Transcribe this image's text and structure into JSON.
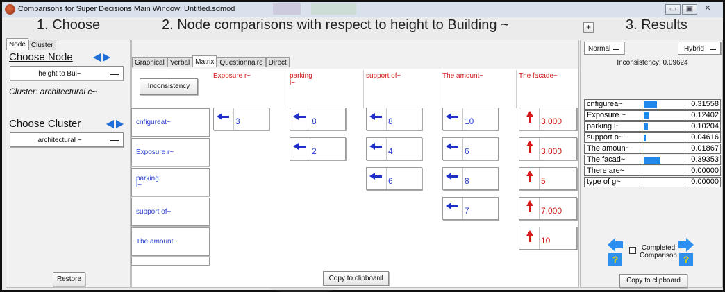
{
  "window": {
    "title": "Comparisons for Super Decisions Main Window: Untitled.sdmod"
  },
  "panels": {
    "choose": "1. Choose",
    "comparisons": "2. Node comparisons with respect to height  to Building ~",
    "results": "3. Results"
  },
  "left": {
    "tabs": [
      "Node",
      "Cluster"
    ],
    "choose_node_label": "Choose Node",
    "node_value": "height to Bui~",
    "cluster_text": "Cluster: architectural c~",
    "choose_cluster_label": "Choose Cluster",
    "cluster_value": "architectural ~",
    "restore": "Restore"
  },
  "middle": {
    "tabs": [
      "Graphical",
      "Verbal",
      "Matrix",
      "Questionnaire",
      "Direct"
    ],
    "inconsistency_button": "Inconsistency",
    "columns": [
      "Exposure r~",
      "parking\nl~",
      "support of~",
      "The amount~",
      "The facade~"
    ],
    "rows": [
      "cnfigureat~",
      "Exposure r~",
      "parking\nl~",
      "support of~",
      "The amount~"
    ],
    "cells": [
      {
        "row": 0,
        "col": 0,
        "dir": "left",
        "value": "3"
      },
      {
        "row": 0,
        "col": 1,
        "dir": "left",
        "value": "8"
      },
      {
        "row": 0,
        "col": 2,
        "dir": "left",
        "value": "8"
      },
      {
        "row": 0,
        "col": 3,
        "dir": "left",
        "value": "10"
      },
      {
        "row": 0,
        "col": 4,
        "dir": "up",
        "value": "3.000"
      },
      {
        "row": 1,
        "col": 1,
        "dir": "left",
        "value": "2"
      },
      {
        "row": 1,
        "col": 2,
        "dir": "left",
        "value": "4"
      },
      {
        "row": 1,
        "col": 3,
        "dir": "left",
        "value": "6"
      },
      {
        "row": 1,
        "col": 4,
        "dir": "up",
        "value": "3.000"
      },
      {
        "row": 2,
        "col": 2,
        "dir": "left",
        "value": "6"
      },
      {
        "row": 2,
        "col": 3,
        "dir": "left",
        "value": "8"
      },
      {
        "row": 2,
        "col": 4,
        "dir": "up",
        "value": "5"
      },
      {
        "row": 3,
        "col": 3,
        "dir": "left",
        "value": "7"
      },
      {
        "row": 3,
        "col": 4,
        "dir": "up",
        "value": "7.000"
      },
      {
        "row": 4,
        "col": 4,
        "dir": "up",
        "value": "10"
      }
    ],
    "copy_button": "Copy to clipboard"
  },
  "results": {
    "plus": "+",
    "mode_left": "Normal",
    "mode_right": "Hybrid",
    "inconsistency": "Inconsistency: 0.09624",
    "rows": [
      {
        "name": "cnfigurea~",
        "value": "0.31558",
        "fraction": 0.31558
      },
      {
        "name": "Exposure ~",
        "value": "0.12402",
        "fraction": 0.12402
      },
      {
        "name": "parking l~",
        "value": "0.10204",
        "fraction": 0.10204
      },
      {
        "name": "support o~",
        "value": "0.04616",
        "fraction": 0.04616
      },
      {
        "name": "The amoun~",
        "value": "0.01867",
        "fraction": 0.01867
      },
      {
        "name": "The facad~",
        "value": "0.39353",
        "fraction": 0.39353
      },
      {
        "name": "There are~",
        "value": "0.00000",
        "fraction": 0
      },
      {
        "name": "type of g~",
        "value": "0.00000",
        "fraction": 0
      }
    ],
    "completed": "Completed",
    "comparison": "Comparison",
    "help_mark": "?",
    "copy_button": "Copy to clipboard"
  },
  "colors": {
    "blue_arrow": "#1f2fc8",
    "red_arrow": "#d81818",
    "bar": "#1f88ea"
  }
}
